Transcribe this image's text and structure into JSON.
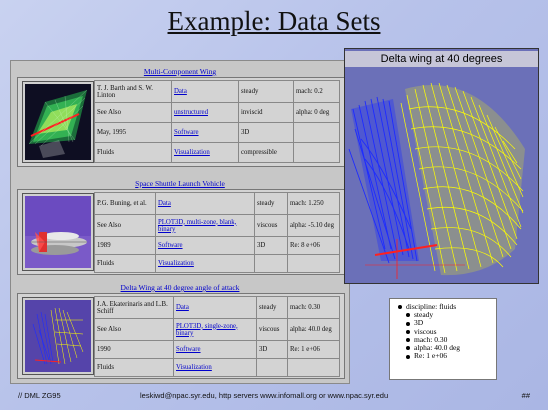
{
  "slide": {
    "title": "Example: Data Sets"
  },
  "entries": [
    {
      "title": "Multi-Component Wing",
      "rows": [
        [
          "T. J. Barth and S. W. Linton",
          "Data",
          "steady",
          "mach: 0.2"
        ],
        [
          "See Also",
          "unstructured",
          "inviscid",
          "alpha: 0 deg"
        ],
        [
          "May, 1995",
          "Software",
          "3D",
          ""
        ],
        [
          "Fluids",
          "Visualization",
          "compressible",
          ""
        ]
      ]
    },
    {
      "title": "Space Shuttle Launch Vehicle",
      "rows": [
        [
          "P.G. Buning, et al.",
          "Data",
          "steady",
          "mach: 1.250"
        ],
        [
          "See Also",
          "PLOT3D, multi-zone, blank, binary",
          "viscous",
          "alpha: -5.10 deg"
        ],
        [
          "1989",
          "Software",
          "3D",
          "Re: 8 e+06"
        ],
        [
          "Fluids",
          "Visualization",
          "",
          ""
        ]
      ]
    },
    {
      "title": "Delta Wing at 40 degree angle of attack",
      "rows": [
        [
          "J.A. Ekaterinaris and L.B. Schiff",
          "Data",
          "steady",
          "mach: 0.30"
        ],
        [
          "See Also",
          "PLOT3D, single-zone, binary",
          "viscous",
          "alpha: 40.0 deg"
        ],
        [
          "1990",
          "Software",
          "3D",
          "Re: 1 e+06"
        ],
        [
          "Fluids",
          "Visualization",
          "",
          ""
        ]
      ]
    }
  ],
  "render": {
    "caption": "Delta wing at 40 degrees"
  },
  "attributes": {
    "top": "discipline: fluids",
    "items": [
      "steady",
      "3D",
      "viscous",
      "mach: 0.30",
      "alpha: 40.0 deg",
      "Re: 1 e+06"
    ]
  },
  "footer": {
    "left": "// DML ZG95",
    "center": "leskiwd@npac.syr.edu, http servers www.infomall.org or www.npac.syr.edu",
    "right": "##"
  },
  "colors": {
    "link": "#0000cc",
    "wing_yellow": "#ffff00",
    "wing_blue": "#1e2cff",
    "bg": "#b7c2ea"
  }
}
